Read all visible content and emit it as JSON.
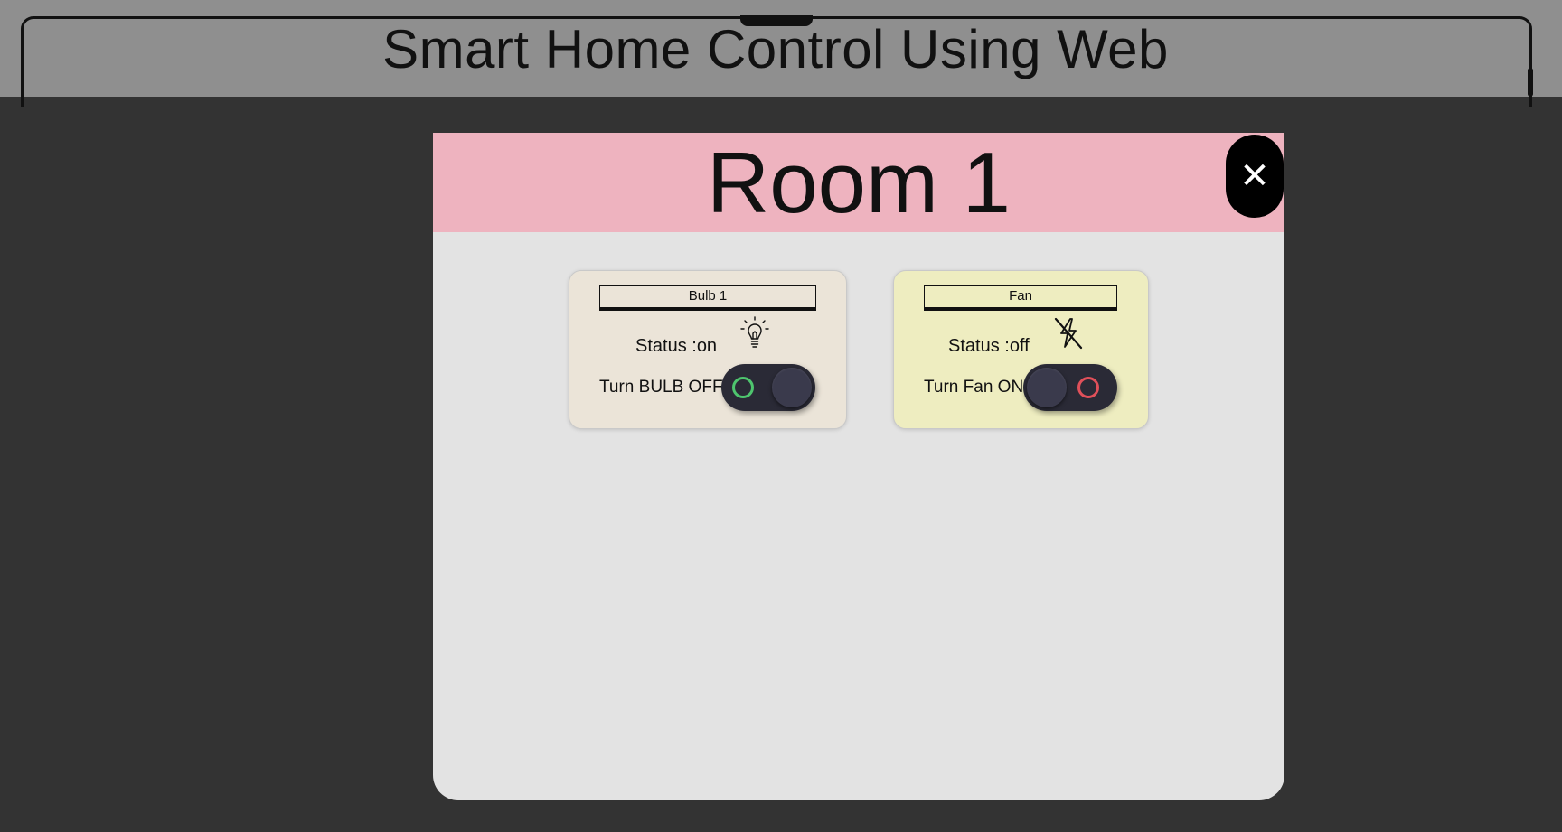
{
  "page": {
    "title": "Smart Home Control Using Web"
  },
  "modal": {
    "title": "Room 1",
    "close_symbol": "✕"
  },
  "devices": [
    {
      "name": "Bulb 1",
      "status_text": "Status :on",
      "status": "on",
      "toggle_label": "Turn BULB OFF",
      "icon": "lightbulb-icon",
      "card_color": "#ebe4d8",
      "indicator_color": "#4ec56e"
    },
    {
      "name": "Fan",
      "status_text": "Status :off",
      "status": "off",
      "toggle_label": "Turn Fan ON",
      "icon": "power-off-icon",
      "card_color": "#eeedc0",
      "indicator_color": "#e0505a"
    }
  ],
  "colors": {
    "background": "#333333",
    "header_bg": "#8f8f8f",
    "modal_header": "#eeb3bf",
    "modal_body": "#e3e3e3"
  }
}
